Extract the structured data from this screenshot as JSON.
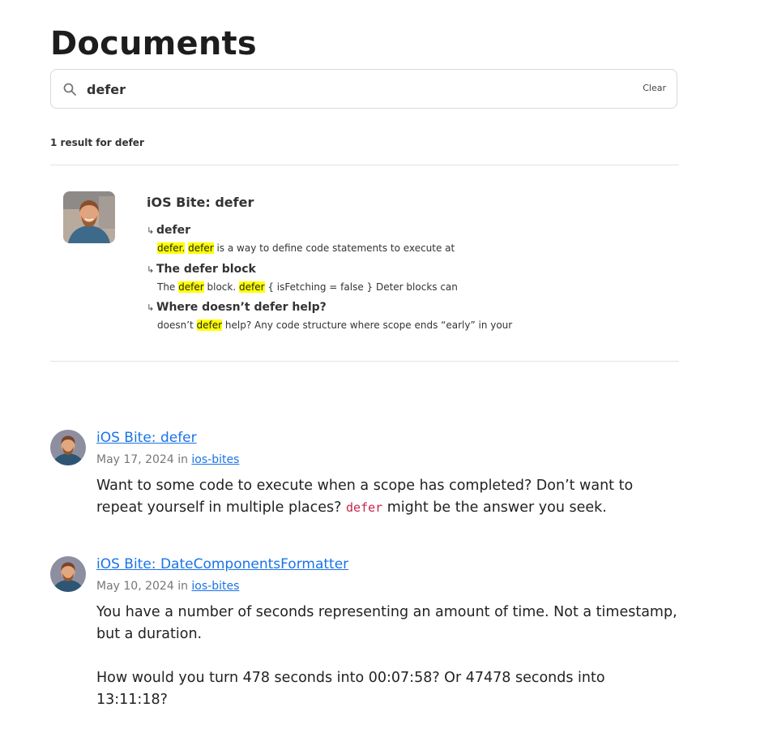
{
  "page": {
    "title": "Documents"
  },
  "search": {
    "value": "defer",
    "placeholder": "",
    "clear_label": "Clear"
  },
  "results_summary": {
    "count_text": "1 result for defer"
  },
  "result": {
    "title": "iOS Bite: defer",
    "sections": [
      {
        "heading": "defer",
        "excerpt_parts": [
          {
            "text": "defer.",
            "highlight": true
          },
          {
            "text": " ",
            "highlight": false
          },
          {
            "text": "defer",
            "highlight": true
          },
          {
            "text": " is a way to define code statements to execute at",
            "highlight": false
          }
        ]
      },
      {
        "heading": "The defer block",
        "excerpt_parts": [
          {
            "text": "The ",
            "highlight": false
          },
          {
            "text": "defer",
            "highlight": true
          },
          {
            "text": " block. ",
            "highlight": false
          },
          {
            "text": "defer",
            "highlight": true
          },
          {
            "text": " { isFetching = false } Deter blocks can",
            "highlight": false
          }
        ]
      },
      {
        "heading": "Where doesn’t defer help?",
        "excerpt_parts": [
          {
            "text": "doesn’t ",
            "highlight": false
          },
          {
            "text": "defer",
            "highlight": true
          },
          {
            "text": " help? Any code structure where scope ends “early” in your",
            "highlight": false
          }
        ]
      }
    ]
  },
  "posts": [
    {
      "title": "iOS Bite: defer",
      "date": "May 17, 2024",
      "in_label": "in",
      "category": "ios-bites",
      "body": [
        [
          {
            "text": "Want to some code to execute when a scope has completed? Don’t want to repeat yourself in multiple places? ",
            "code": false
          },
          {
            "text": "defer",
            "code": true
          },
          {
            "text": " might be the answer you seek.",
            "code": false
          }
        ]
      ]
    },
    {
      "title": "iOS Bite: DateComponentsFormatter",
      "date": "May 10, 2024",
      "in_label": "in",
      "category": "ios-bites",
      "body": [
        [
          {
            "text": "You have a number of seconds representing an amount of time. Not a timestamp, but a duration.",
            "code": false
          }
        ],
        [
          {
            "text": "How would you turn 478 seconds into 00:07:58? Or 47478 seconds into 13:11:18?",
            "code": false
          }
        ]
      ]
    }
  ],
  "icons": {
    "search": "search-icon",
    "section_arrow": "return-arrow-icon"
  },
  "colors": {
    "link": "#1a73e8",
    "highlight": "#ffff00",
    "code": "#c7254e"
  }
}
